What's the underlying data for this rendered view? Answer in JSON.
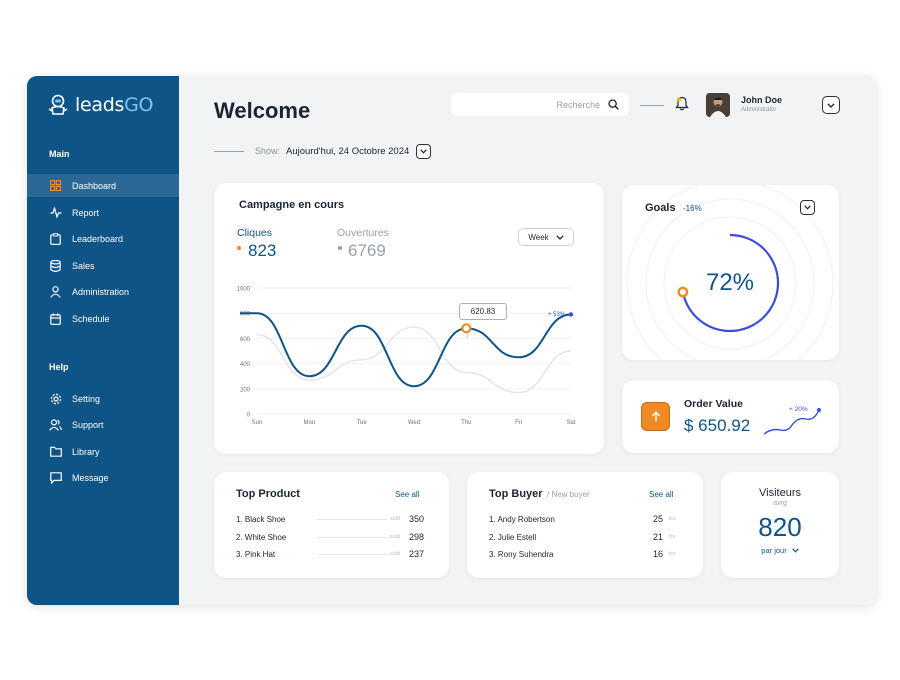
{
  "sidebar": {
    "logo": {
      "prefix": "leads",
      "suffix": "GO"
    },
    "main_label": "Main",
    "help_label": "Help",
    "main_items": [
      {
        "label": "Dashboard",
        "icon": "grid-icon"
      },
      {
        "label": "Report",
        "icon": "activity-icon"
      },
      {
        "label": "Leaderboard",
        "icon": "clipboard-icon"
      },
      {
        "label": "Sales",
        "icon": "database-icon"
      },
      {
        "label": "Administration",
        "icon": "user-icon"
      },
      {
        "label": "Schedule",
        "icon": "calendar-icon"
      }
    ],
    "help_items": [
      {
        "label": "Setting",
        "icon": "gear-icon"
      },
      {
        "label": "Support",
        "icon": "users-icon"
      },
      {
        "label": "Library",
        "icon": "folder-icon"
      },
      {
        "label": "Message",
        "icon": "message-icon"
      }
    ]
  },
  "header": {
    "title": "Welcome",
    "search_placeholder": "Recherche",
    "user_name": "John Doe",
    "user_role": "Administrator",
    "show_label": "Show:",
    "show_value": "Aujourd'hui, 24 Octobre 2024"
  },
  "campaign": {
    "title": "Campagne en cours",
    "clicks_label": "Cliques",
    "clicks_value": "823",
    "opens_label": "Ouvertures",
    "opens_value": "6769",
    "period": "Week",
    "tooltip": "620.83",
    "change": "+ 53%"
  },
  "chart_data": {
    "type": "line",
    "categories": [
      "Sun",
      "Mon",
      "Tue",
      "Wed",
      "Thu",
      "Fri",
      "Sat"
    ],
    "ylim": [
      0,
      1000
    ],
    "yticks": [
      0,
      200,
      400,
      600,
      800,
      1000
    ],
    "series": [
      {
        "name": "Cliques",
        "values": [
          800,
          300,
          700,
          220,
          680,
          450,
          790
        ]
      },
      {
        "name": "Ouvertures",
        "values": [
          630,
          270,
          430,
          690,
          330,
          170,
          500
        ]
      }
    ],
    "colors": {
      "Cliques": "#0e5487",
      "Ouvertures": "#e1e3e7",
      "marker": "#f08a24"
    }
  },
  "goals": {
    "label": "Goals",
    "change": "-16%",
    "percent": "72%",
    "progress": 0.72
  },
  "order": {
    "label": "Order Value",
    "value": "$ 650.92",
    "change": "+ 20%"
  },
  "top_product": {
    "title": "Top Product",
    "see_all": "See all",
    "sold_label": "sold",
    "items": [
      {
        "name": "1. Black Shoe",
        "value": "350"
      },
      {
        "name": "2. White Shoe",
        "value": "298"
      },
      {
        "name": "3. Pink Hat",
        "value": "237"
      }
    ]
  },
  "top_buyer": {
    "title": "Top Buyer",
    "subtitle": "/ New buyer",
    "see_all": "See all",
    "unit": "trs",
    "items": [
      {
        "name": "1. Andy Robertson",
        "value": "25"
      },
      {
        "name": "2. Julie Estell",
        "value": "21"
      },
      {
        "name": "3. Rony Suhendra",
        "value": "16"
      }
    ]
  },
  "visitors": {
    "title": "Visiteurs",
    "sub": "avrg",
    "value": "820",
    "period": "par jour"
  }
}
